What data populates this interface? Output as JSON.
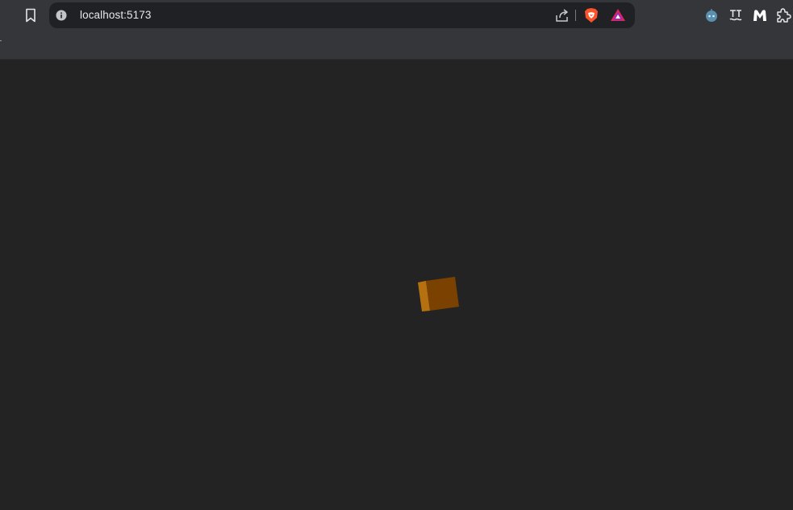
{
  "browser": {
    "address_bar": {
      "url": "localhost:5173"
    },
    "omnibox_icons": [
      "site-info-icon",
      "share-icon",
      "brave-shields-icon",
      "brave-rewards-icon"
    ],
    "extensions": [
      "robot-extension-icon",
      "translate-extension-icon",
      "malwarebytes-extension-icon",
      "puzzle-extensions-icon"
    ]
  },
  "colors": {
    "toolbar": "#35363a",
    "omnibox": "#202124",
    "canvas": "#232323",
    "cube_front": "#7a4100",
    "cube_side": "#b5700f",
    "brave_orange": "#fb542b",
    "rewards_red": "#e0245e"
  }
}
